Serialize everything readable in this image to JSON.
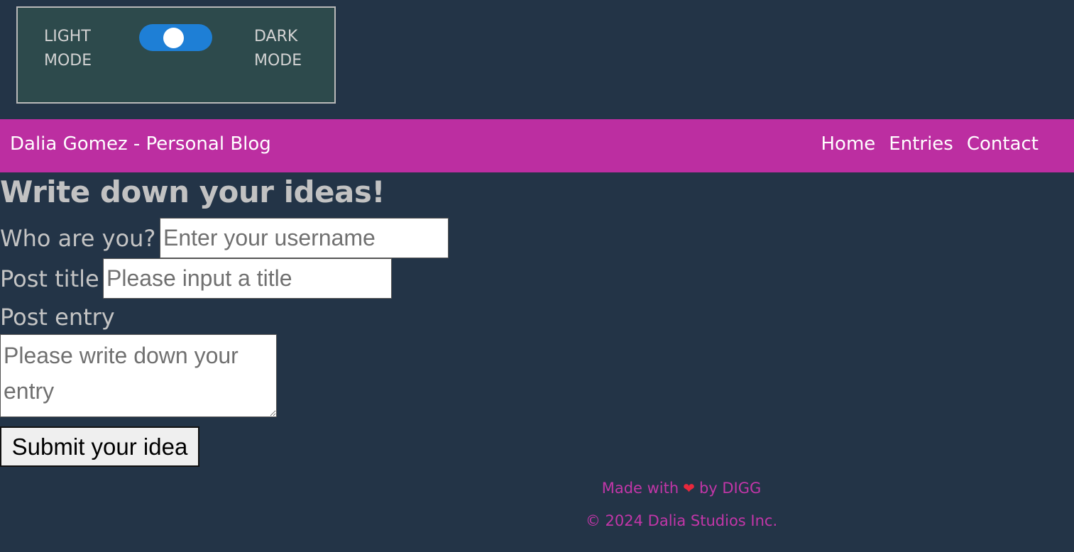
{
  "theme_toggle": {
    "light_label_line1": "LIGHT",
    "light_label_line2": "MODE",
    "dark_label_line1": "DARK",
    "dark_label_line2": "MODE",
    "state": "dark",
    "accent_color": "#1e7fd6"
  },
  "navbar": {
    "brand": "Dalia Gomez - Personal Blog",
    "links": [
      "Home",
      "Entries",
      "Contact"
    ],
    "background_color": "#bc2ea1"
  },
  "form": {
    "heading": "Write down your ideas!",
    "username_label": "Who are you?",
    "username_placeholder": "Enter your username",
    "title_label": "Post title",
    "title_placeholder": "Please input a title",
    "entry_label": "Post entry",
    "entry_placeholder": "Please write down your entry",
    "submit_label": "Submit your idea"
  },
  "footer": {
    "made_prefix": "Made with",
    "heart_icon": "heart-icon",
    "made_suffix": "by DIGG",
    "copyright": "© 2024 Dalia Studios Inc.",
    "text_color": "#c236a8"
  }
}
